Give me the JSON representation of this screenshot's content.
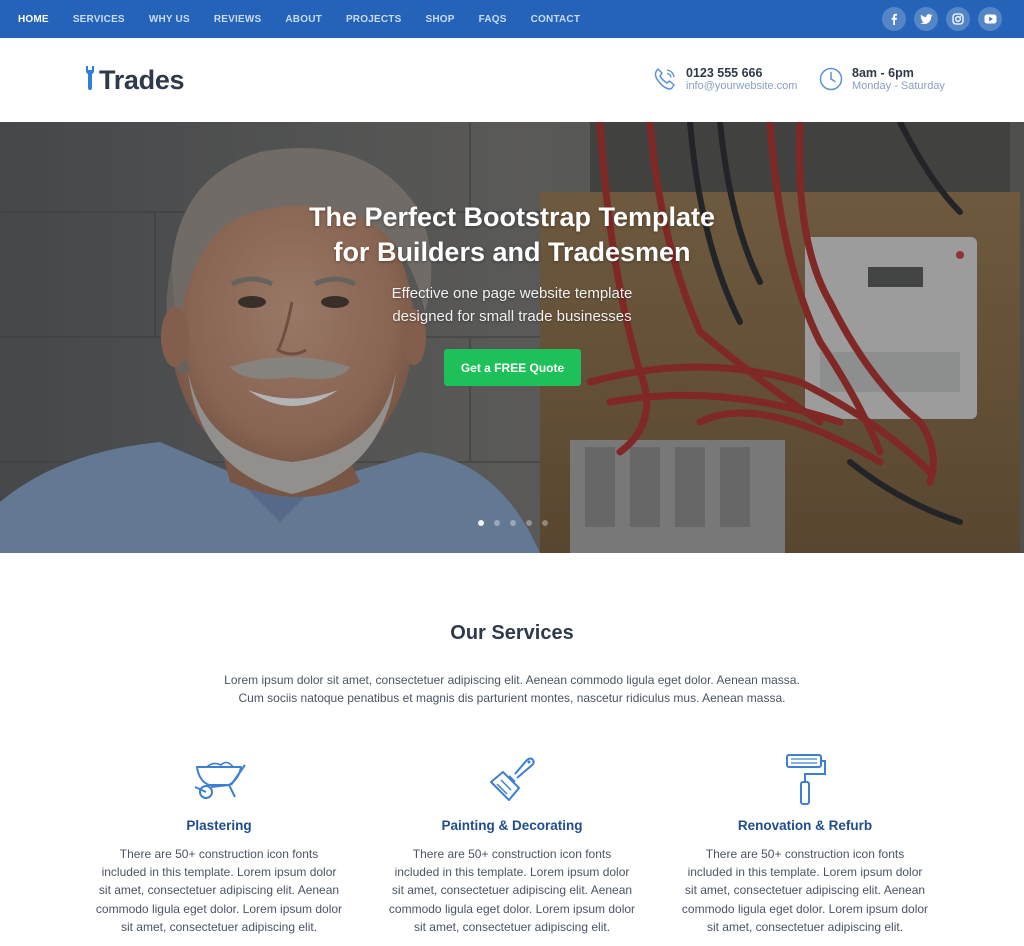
{
  "nav": {
    "items": [
      {
        "label": "HOME",
        "active": true
      },
      {
        "label": "SERVICES",
        "active": false
      },
      {
        "label": "WHY US",
        "active": false
      },
      {
        "label": "REVIEWS",
        "active": false
      },
      {
        "label": "ABOUT",
        "active": false
      },
      {
        "label": "PROJECTS",
        "active": false
      },
      {
        "label": "SHOP",
        "active": false
      },
      {
        "label": "FAQS",
        "active": false
      },
      {
        "label": "CONTACT",
        "active": false
      }
    ],
    "socials": [
      "facebook-icon",
      "twitter-icon",
      "instagram-icon",
      "youtube-icon"
    ],
    "background": "#2563b8"
  },
  "header": {
    "logo_text": "Trades",
    "phone": "0123 555 666",
    "email": "info@yourwebsite.com",
    "hours": "8am - 6pm",
    "days": "Monday - Saturday",
    "accent": "#2f80d8"
  },
  "hero": {
    "title_line1": "The Perfect Bootstrap Template",
    "title_line2": "for Builders and Tradesmen",
    "subtitle_line1": "Effective one page website template",
    "subtitle_line2": "designed for small trade businesses",
    "cta_label": "Get a FREE Quote",
    "cta_color": "#1ec05a",
    "slides": 5,
    "active_slide": 1
  },
  "services": {
    "title": "Our Services",
    "intro_line1": "Lorem ipsum dolor sit amet, consectetuer adipiscing elit. Aenean commodo ligula eget dolor. Aenean massa.",
    "intro_line2": "Cum sociis natoque penatibus et magnis dis parturient montes, nascetur ridiculus mus. Aenean massa.",
    "items": [
      {
        "icon": "wheelbarrow-icon",
        "title": "Plastering",
        "lines": [
          "There are 50+ construction icon fonts",
          "included in this template. Lorem ipsum dolor",
          "sit amet, consectetuer adipiscing elit. Aenean",
          "commodo ligula eget dolor. Lorem ipsum dolor",
          "sit amet, consectetuer adipiscing elit."
        ]
      },
      {
        "icon": "paintbrush-icon",
        "title": "Painting & Decorating",
        "lines": [
          "There are 50+ construction icon fonts",
          "included in this template. Lorem ipsum dolor",
          "sit amet, consectetuer adipiscing elit. Aenean",
          "commodo ligula eget dolor. Lorem ipsum dolor",
          "sit amet, consectetuer adipiscing elit."
        ]
      },
      {
        "icon": "paint-roller-icon",
        "title": "Renovation & Refurb",
        "lines": [
          "There are 50+ construction icon fonts",
          "included in this template. Lorem ipsum dolor",
          "sit amet, consectetuer adipiscing elit. Aenean",
          "commodo ligula eget dolor. Lorem ipsum dolor",
          "sit amet, consectetuer adipiscing elit."
        ]
      }
    ],
    "title_color": "#1f4d8f"
  }
}
